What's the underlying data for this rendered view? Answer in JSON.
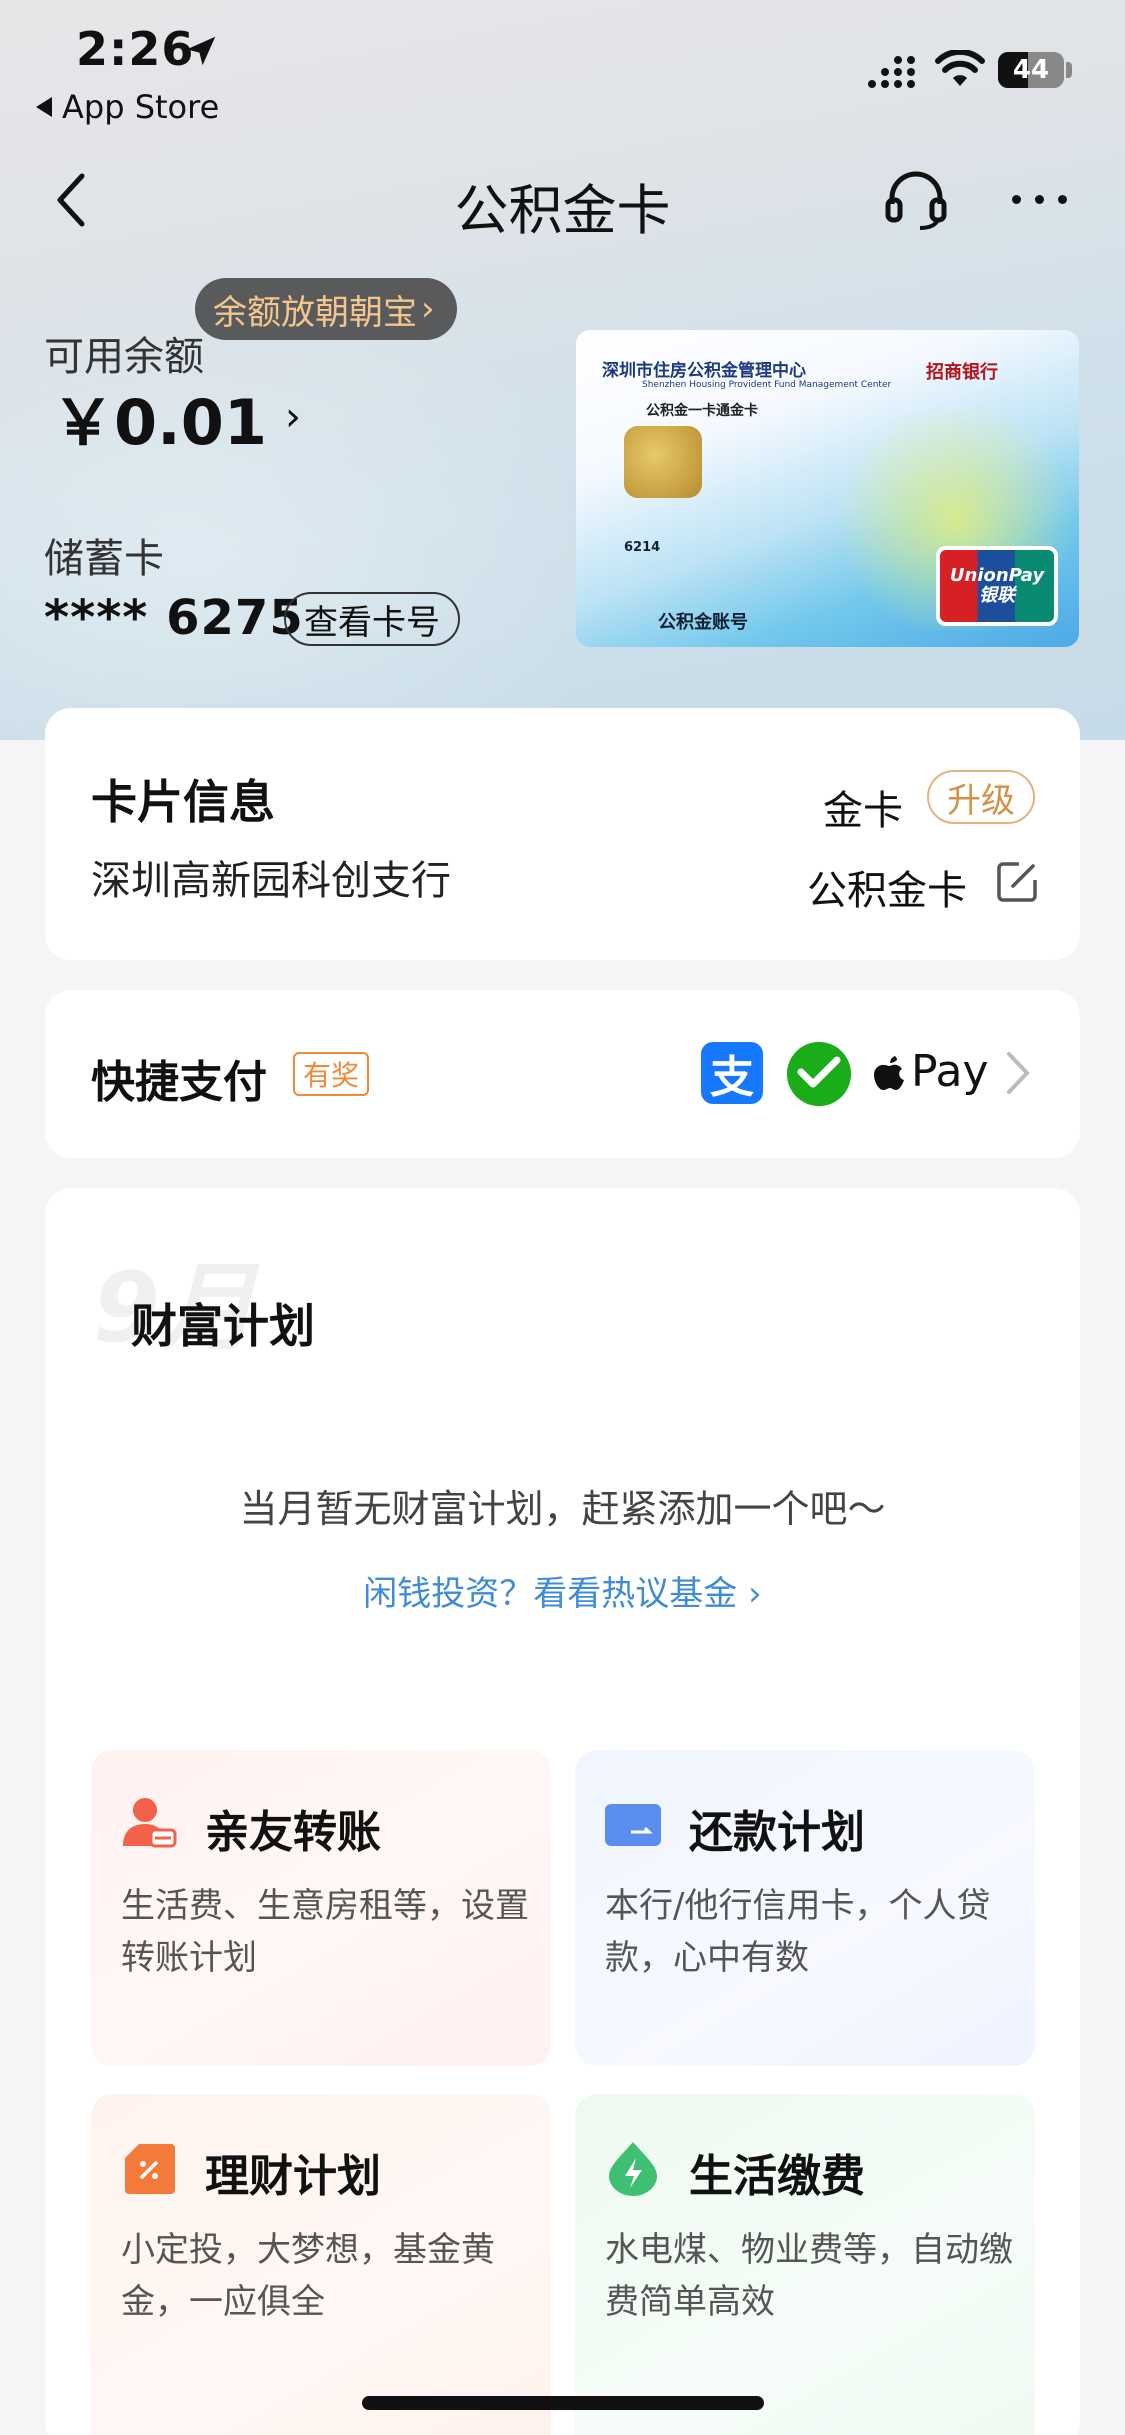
{
  "status_bar": {
    "time": "2:26",
    "back_app": "App Store",
    "battery": "44"
  },
  "nav": {
    "title": "公积金卡"
  },
  "balance": {
    "promo_tag": "余额放朝朝宝",
    "label": "可用余额",
    "amount": "￥0.01",
    "card_type": "储蓄卡",
    "card_number": "**** 6275",
    "view_card_button": "查看卡号"
  },
  "card_image": {
    "center_name": "深圳市住房公积金管理中心",
    "center_name_en": "Shenzhen Housing Provident Fund Management Center",
    "bank_name": "招商银行",
    "product": "公积金一卡通金卡",
    "number_prefix": "6214",
    "account_label": "公积金账号",
    "unionpay_en": "UnionPay",
    "unionpay_cn": "银联"
  },
  "card_info": {
    "title": "卡片信息",
    "branch": "深圳高新园科创支行",
    "level": "金卡",
    "upgrade_label": "升级",
    "card_name": "公积金卡"
  },
  "quick_pay": {
    "title": "快捷支付",
    "badge": "有奖",
    "alipay_glyph": "支",
    "applepay_label": "Pay"
  },
  "wealth_plan": {
    "month_watermark": "9月",
    "title": "财富计划",
    "empty_text": "当月暂无财富计划，赶紧添加一个吧～",
    "link_text": "闲钱投资？看看热议基金 ›",
    "tiles": [
      {
        "title": "亲友转账",
        "desc": "生活费、生意房租等，设置转账计划",
        "icon": "person-transfer-icon"
      },
      {
        "title": "还款计划",
        "desc": "本行/他行信用卡，个人贷款，心中有数",
        "icon": "card-repay-icon"
      },
      {
        "title": "理财计划",
        "desc": "小定投，大梦想，基金黄金，一应俱全",
        "icon": "finance-tag-icon"
      },
      {
        "title": "生活缴费",
        "desc": "水电煤、物业费等，自动缴费简单高效",
        "icon": "bolt-icon"
      }
    ]
  },
  "colors": {
    "accent_blue": "#3e8bd9",
    "gold": "#d49246",
    "badge_orange": "#f08a3a"
  }
}
